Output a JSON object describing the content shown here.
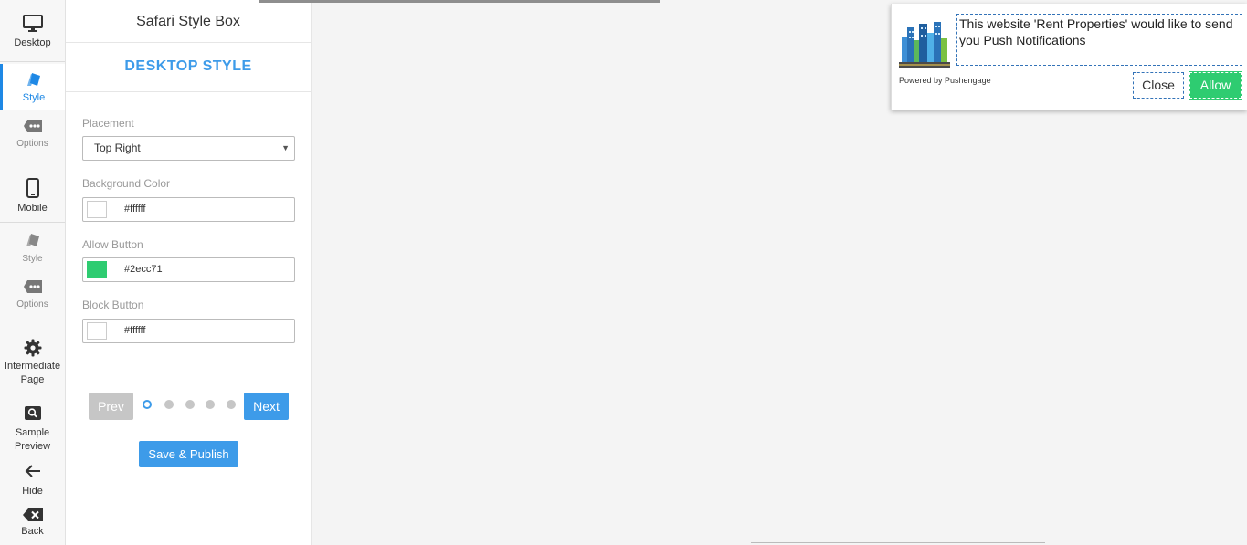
{
  "rail": {
    "desktop": {
      "label": "Desktop",
      "icon": "monitor-icon"
    },
    "desktop_style": {
      "label": "Style",
      "icon": "palette-icon"
    },
    "desktop_options": {
      "label": "Options",
      "icon": "options-icon"
    },
    "mobile": {
      "label": "Mobile",
      "icon": "mobile-icon"
    },
    "mobile_style": {
      "label": "Style",
      "icon": "palette-icon"
    },
    "mobile_options": {
      "label": "Options",
      "icon": "options-icon"
    },
    "intermediate": {
      "label_line1": "Intermediate",
      "label_line2": "Page",
      "icon": "gear-icon"
    },
    "sample": {
      "label_line1": "Sample",
      "label_line2": "Preview",
      "icon": "magnifier-icon"
    },
    "hide": {
      "label": "Hide",
      "icon": "arrow-left-icon"
    },
    "back": {
      "label": "Back",
      "icon": "backspace-icon"
    }
  },
  "panel": {
    "title": "Safari Style Box",
    "section_heading": "DESKTOP STYLE",
    "placement": {
      "label": "Placement",
      "value": "Top Right"
    },
    "background_color": {
      "label": "Background Color",
      "value": "#ffffff"
    },
    "allow_button": {
      "label": "Allow Button",
      "value": "#2ecc71"
    },
    "block_button": {
      "label": "Block Button",
      "value": "#ffffff"
    },
    "pager": {
      "prev": "Prev",
      "next": "Next",
      "current_step": 1,
      "total_steps": 5
    },
    "save_publish": "Save & Publish"
  },
  "notification": {
    "message": "This website 'Rent Properties' would like to send you Push Notifications",
    "powered_by": "Powered by Pushengage",
    "close_label": "Close",
    "allow_label": "Allow"
  },
  "colors": {
    "accent": "#3d9be9",
    "allow": "#2ecc71",
    "prev_disabled": "#c6c6c6"
  }
}
